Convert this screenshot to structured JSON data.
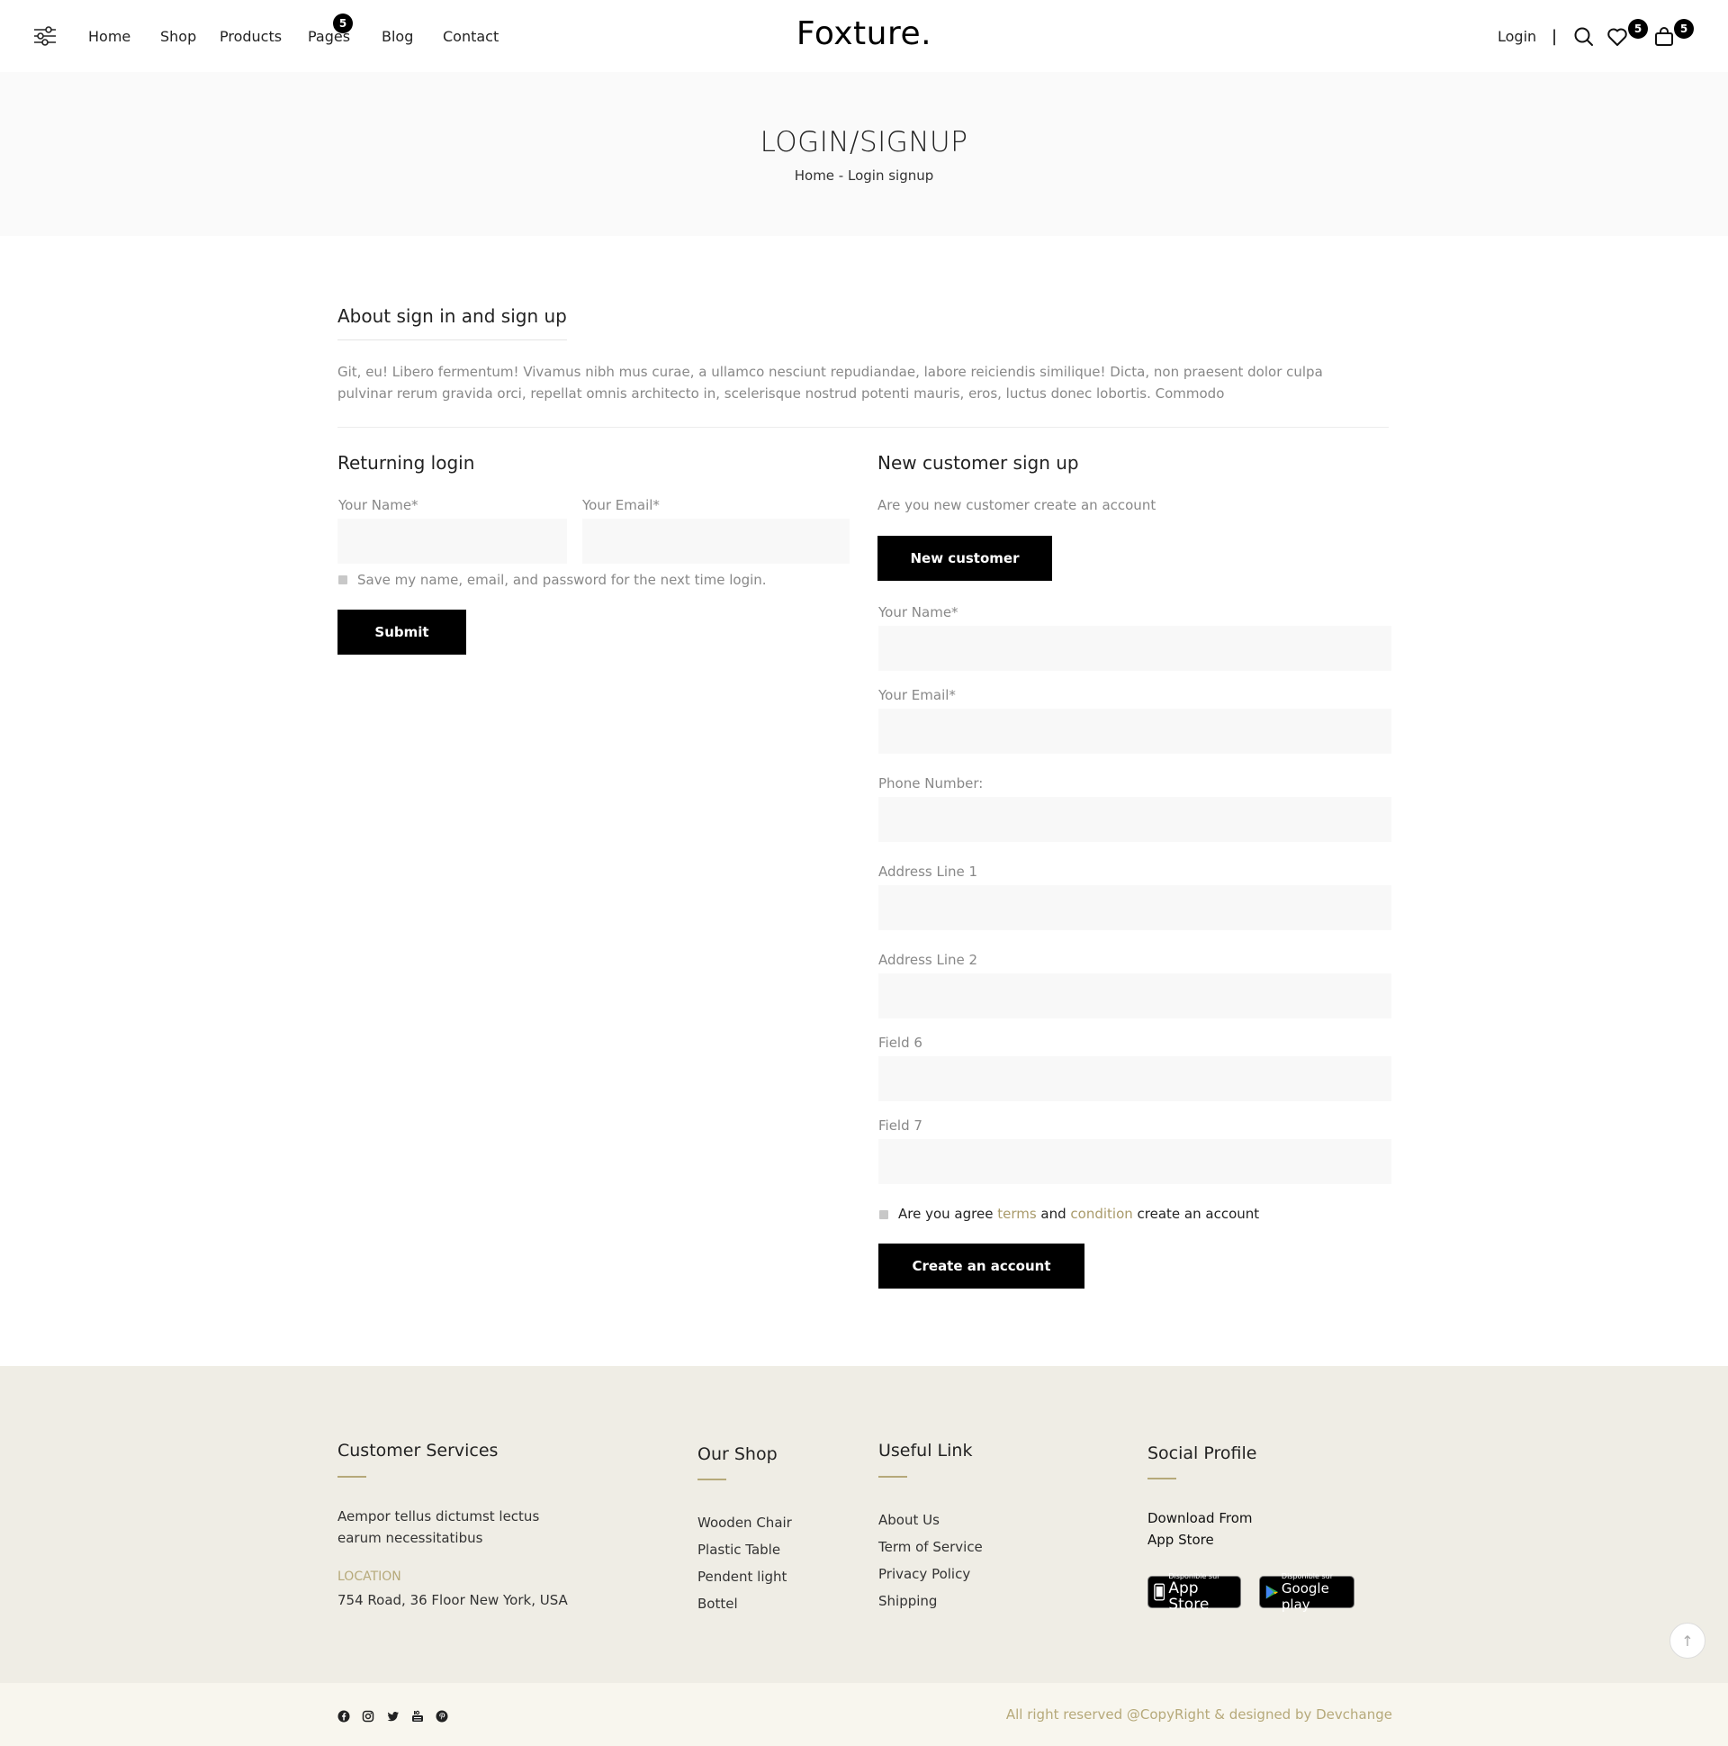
{
  "header": {
    "nav": [
      "Home",
      "Shop",
      "Products",
      "Pages",
      "Blog",
      "Contact"
    ],
    "pages_badge": "5",
    "logo": "Foxture.",
    "login": "Login",
    "separator": "|",
    "wishlist_badge": "5",
    "cart_badge": "5"
  },
  "banner": {
    "title": "LOGIN/SIGNUP",
    "breadcrumb_home": "Home",
    "breadcrumb_sep": " - ",
    "breadcrumb_current": "Login signup"
  },
  "about": {
    "title": "About sign in and sign up",
    "text": "Git, eu! Libero fermentum! Vivamus nibh mus curae, a ullamco nesciunt repudiandae, labore reiciendis similique! Dicta, non praesent dolor culpa pulvinar rerum gravida orci, repellat omnis architecto in, scelerisque nostrud potenti mauris, eros, luctus donec lobortis. Commodo"
  },
  "login": {
    "title": "Returning login",
    "name_label": "Your Name*",
    "email_label": "Your Email*",
    "name_value": "",
    "email_value": "",
    "remember": "Save my name, email, and password for the next time login.",
    "submit": "Submit"
  },
  "signup": {
    "title": "New customer sign up",
    "subtitle": "Are you new customer create an account",
    "new_customer_button": "New customer",
    "fields": [
      "Your Name*",
      "Your Email*",
      "Phone Number:",
      "Address Line 1",
      "Address Line 2",
      "Field 6",
      "Field 7"
    ],
    "agree_prefix": "Are you agree ",
    "agree_terms": "terms",
    "agree_and": " and ",
    "agree_condition": "condition",
    "agree_suffix": " create an account",
    "create_button": "Create an account"
  },
  "footer": {
    "customer_services": {
      "title": "Customer Services",
      "text_line1": "Aempor tellus dictumst lectus",
      "text_line2": "earum necessitatibus",
      "location_label": "LOCATION",
      "address": "754 Road, 36 Floor New York, USA"
    },
    "our_shop": {
      "title": "Our Shop",
      "links": [
        "Wooden Chair",
        "Plastic Table",
        "Pendent light",
        "Bottel"
      ]
    },
    "useful_link": {
      "title": "Useful Link",
      "links": [
        "About Us",
        "Term of Service",
        "Privacy Policy",
        "Shipping"
      ]
    },
    "social_profile": {
      "title": "Social Profile",
      "download_line1": "Download From",
      "download_line2": "App Store",
      "appstore_small": "Disponible sur",
      "appstore_big": "App Store",
      "googleplay_small": "Disponible sur",
      "googleplay_big": "Google play"
    },
    "to_top": "↑",
    "copyright": "All right reserved @CopyRight & designed by Devchange",
    "social_icons": [
      "facebook-icon",
      "instagram-icon",
      "twitter-icon",
      "youtube-icon",
      "pinterest-icon"
    ]
  },
  "colors": {
    "accent_gold": "#b6a97a",
    "button_bg": "#000000",
    "footer_bg": "#efede5",
    "bottom_bar_bg": "#f8f6ee"
  }
}
